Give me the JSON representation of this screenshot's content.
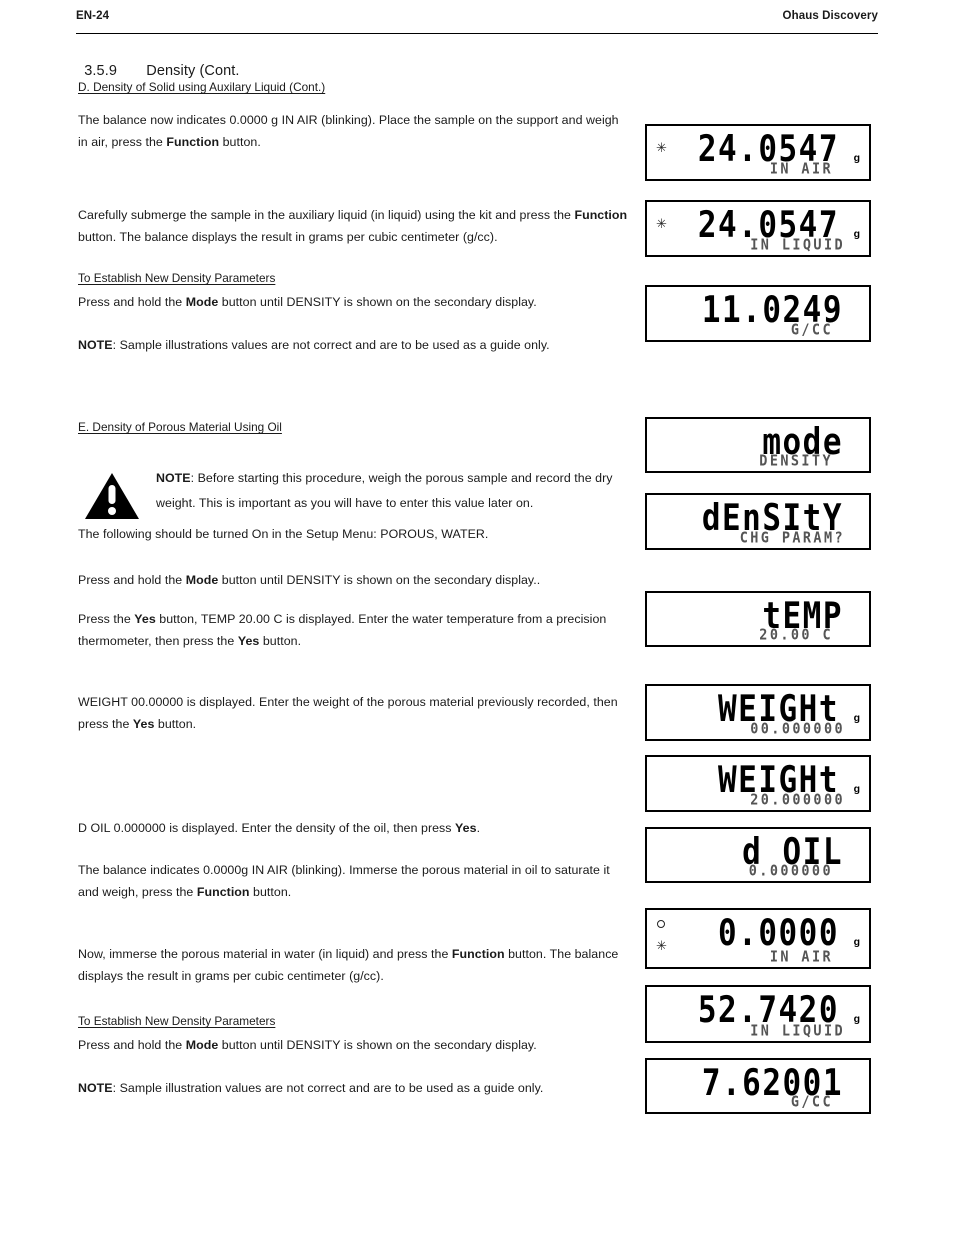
{
  "header": {
    "page_number": "EN-24",
    "product": "Ohaus Discovery"
  },
  "section": {
    "number": "3.5.9",
    "title": "Density (Cont."
  },
  "subheadings": {
    "d": "D. Density of Solid using Auxilary Liquid (Cont.)",
    "e": "E. Density of Porous Material Using Oil",
    "establish_1": "To Establish New Density Parameters",
    "establish_2": "To Establish New Density Parameters"
  },
  "paragraphs": {
    "p1_a": "The balance now indicates 0.0000 g IN AIR (blinking).  Place the sample on the support and weigh in air, press the ",
    "p1_b": "Function",
    "p1_c": " button.",
    "p2_a": "Carefully submerge the sample in the auxiliary liquid (in liquid) using the kit and press the ",
    "p2_b": "Function",
    "p2_c": " button.  The balance displays the result in grams per cubic centimeter (g/cc).",
    "p3_a": "Press and hold the ",
    "p3_b": "Mode",
    "p3_c": " button until DENSITY is shown on the secondary display.",
    "p4_a": "NOTE",
    "p4_b": ": Sample illustrations values are not correct and are to be used as a guide only.",
    "note_a": "NOTE",
    "note_b": ": Before starting this procedure, weigh the porous sample and record the dry weight.  This is important as you will have to enter this value later on.",
    "p5": "The following should be turned On in the Setup Menu: POROUS, WATER.",
    "p6_a": "Press and hold the ",
    "p6_b": "Mode",
    "p6_c": " button until DENSITY is shown on the secondary display..",
    "p7_a": "Press the ",
    "p7_b": "Yes",
    "p7_c": " button, TEMP 20.00  C is displayed.  Enter the water temperature from a precision thermometer, then press the ",
    "p7_d": "Yes",
    "p7_e": " button.",
    "p8_a": "WEIGHT 00.00000 is displayed.  Enter the weight of the porous material previously recorded, then press the ",
    "p8_b": "Yes",
    "p8_c": " button.",
    "p9_a": "D OIL 0.000000 is displayed.  Enter the density of the oil, then press ",
    "p9_b": "Yes",
    "p9_c": ".",
    "p10_a": "The balance indicates 0.0000g IN AIR (blinking).  Immerse the porous material in oil to saturate it and weigh, press the ",
    "p10_b": "Function",
    "p10_c": " button.",
    "p11_a": "Now, immerse the porous material in water (in liquid) and press the ",
    "p11_b": "Function",
    "p11_c": " button.  The balance displays the result in grams per cubic centimeter (g/cc).",
    "p12_a": "Press and hold the ",
    "p12_b": "Mode",
    "p12_c": " button until DENSITY is shown on the secondary display.",
    "p13_a": "NOTE",
    "p13_b": ": Sample illustration values are not correct and are to be used as a guide only."
  },
  "displays": [
    {
      "id": "lcd1",
      "main": "24.0547",
      "secondary": "IN AIR",
      "unit": "g",
      "annunciators": [
        "star"
      ]
    },
    {
      "id": "lcd2",
      "main": "24.0547",
      "secondary": "IN LIQUID",
      "unit": "g",
      "annunciators": [
        "star"
      ]
    },
    {
      "id": "lcd3",
      "main": "11.0249",
      "secondary": "G/CC",
      "unit": "",
      "annunciators": []
    },
    {
      "id": "lcd4",
      "main": "mode",
      "secondary": "DENSITY",
      "unit": "",
      "annunciators": []
    },
    {
      "id": "lcd5",
      "main": "dEnSItY",
      "secondary": "CHG PARAM?",
      "unit": "",
      "annunciators": []
    },
    {
      "id": "lcd6",
      "main": "tEMP",
      "secondary": "20.00 C",
      "unit": "",
      "annunciators": []
    },
    {
      "id": "lcd7",
      "main": "WEIGHt",
      "secondary": "00.000000",
      "unit": "g",
      "annunciators": []
    },
    {
      "id": "lcd8",
      "main": "WEIGHt",
      "secondary": "20.000000",
      "unit": "g",
      "annunciators": []
    },
    {
      "id": "lcd9",
      "main": "d OIL",
      "secondary": "0.000000",
      "unit": "",
      "annunciators": []
    },
    {
      "id": "lcd10",
      "main": "0.0000",
      "secondary": "IN AIR",
      "unit": "g",
      "annunciators": [
        "circle",
        "star"
      ]
    },
    {
      "id": "lcd11",
      "main": "52.7420",
      "secondary": "IN LIQUID",
      "unit": "g",
      "annunciators": []
    },
    {
      "id": "lcd12",
      "main": "7.62001",
      "secondary": "G/CC",
      "unit": "",
      "annunciators": []
    }
  ],
  "icons": {
    "warning": "warning-triangle",
    "star_annunciator": "✳",
    "stable_annunciator": "circle"
  }
}
